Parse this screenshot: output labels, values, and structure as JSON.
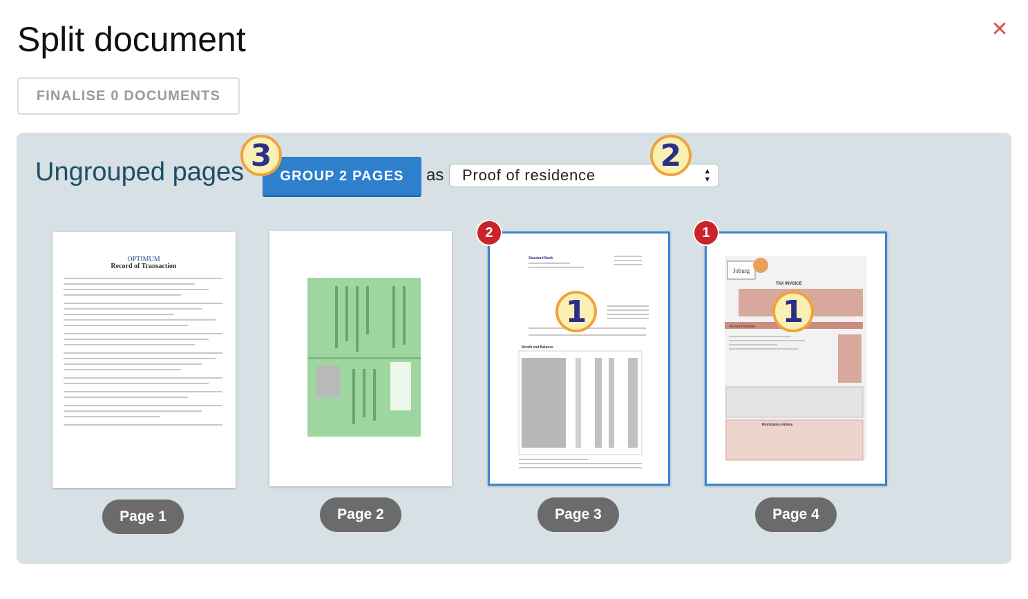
{
  "dialog": {
    "title": "Split document",
    "close_icon": "close-icon"
  },
  "toolbar": {
    "finalise_label": "FINALISE 0 DOCUMENTS"
  },
  "ungrouped": {
    "title": "Ungrouped pages",
    "group_button_label": "GROUP 2 PAGES",
    "as_label": "as",
    "document_type_selected": "Proof of residence"
  },
  "callouts": {
    "group_button": "3",
    "select": "2",
    "page3": "1",
    "page4": "1"
  },
  "pages": [
    {
      "label": "Page 1",
      "selected": false,
      "order": ""
    },
    {
      "label": "Page 2",
      "selected": false,
      "order": ""
    },
    {
      "label": "Page 3",
      "selected": true,
      "order": "2"
    },
    {
      "label": "Page 4",
      "selected": true,
      "order": "1"
    }
  ],
  "thumbnails": {
    "page1_brand": "OPTIMUM",
    "page1_heading": "Record of Transaction",
    "page3_bank": "Standard Bank",
    "page3_section": "Month end Balance",
    "page4_brand": "Joburg",
    "page4_heading": "TAX INVOICE",
    "page4_account": "Account Number",
    "page4_advice": "Remittance Advice"
  },
  "colors": {
    "accent": "#2e7fcc",
    "panel_bg": "#d6e0e5",
    "selected_border": "#3a86cf",
    "badge": "#c9242a",
    "close": "#d9534f"
  }
}
